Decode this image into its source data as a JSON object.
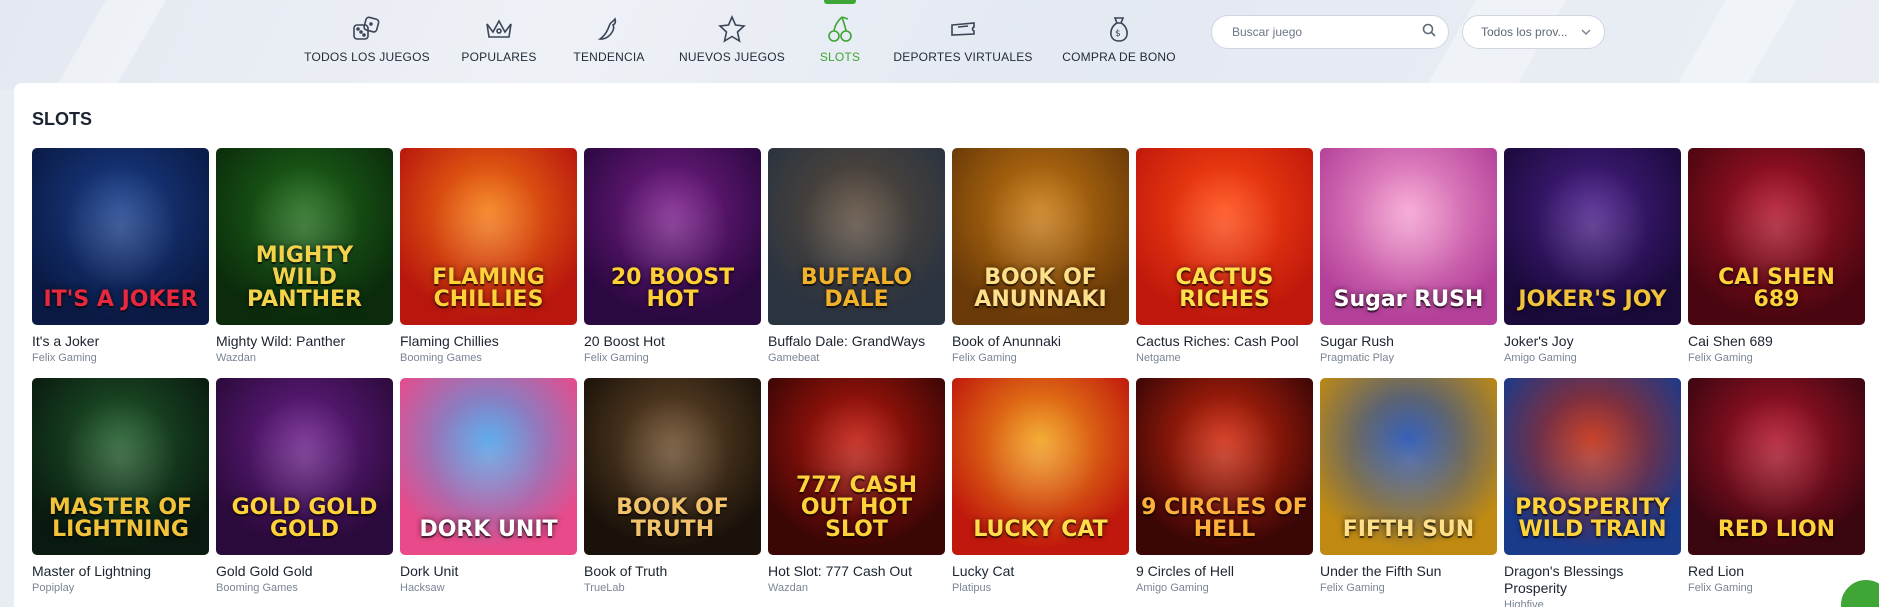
{
  "nav": {
    "items": [
      {
        "label": "TODOS LOS JUEGOS",
        "icon": "dice-icon"
      },
      {
        "label": "POPULARES",
        "icon": "crown-icon"
      },
      {
        "label": "TENDENCIA",
        "icon": "chili-icon"
      },
      {
        "label": "NUEVOS JUEGOS",
        "icon": "star-icon"
      },
      {
        "label": "SLOTS",
        "icon": "cherries-icon",
        "active": true
      },
      {
        "label": "DEPORTES VIRTUALES",
        "icon": "ticket-icon"
      },
      {
        "label": "COMPRA DE BONO",
        "icon": "money-bag-icon"
      }
    ],
    "active_color": "#3fa535"
  },
  "search": {
    "placeholder": "Buscar juego"
  },
  "provider_select": {
    "value": "Todos los prov..."
  },
  "section": {
    "title": "SLOTS"
  },
  "games": [
    {
      "name": "It's a Joker",
      "provider": "Felix Gaming",
      "logo": "IT'S A JOKER"
    },
    {
      "name": "Mighty Wild: Panther",
      "provider": "Wazdan",
      "logo": "MIGHTY WILD PANTHER"
    },
    {
      "name": "Flaming Chillies",
      "provider": "Booming Games",
      "logo": "FLAMING CHILLIES"
    },
    {
      "name": "20 Boost Hot",
      "provider": "Felix Gaming",
      "logo": "20 BOOST HOT"
    },
    {
      "name": "Buffalo Dale: GrandWays",
      "provider": "Gamebeat",
      "logo": "BUFFALO DALE"
    },
    {
      "name": "Book of Anunnaki",
      "provider": "Felix Gaming",
      "logo": "BOOK OF ANUNNAKI"
    },
    {
      "name": "Cactus Riches: Cash Pool",
      "provider": "Netgame",
      "logo": "CACTUS RICHES"
    },
    {
      "name": "Sugar Rush",
      "provider": "Pragmatic Play",
      "logo": "Sugar RUSH"
    },
    {
      "name": "Joker's Joy",
      "provider": "Amigo Gaming",
      "logo": "JOKER'S JOY"
    },
    {
      "name": "Cai Shen 689",
      "provider": "Felix Gaming",
      "logo": "CAI SHEN 689"
    },
    {
      "name": "Master of Lightning",
      "provider": "Popiplay",
      "logo": "MASTER OF LIGHTNING"
    },
    {
      "name": "Gold Gold Gold",
      "provider": "Booming Games",
      "logo": "GOLD GOLD GOLD"
    },
    {
      "name": "Dork Unit",
      "provider": "Hacksaw",
      "logo": "DORK UNIT"
    },
    {
      "name": "Book of Truth",
      "provider": "TrueLab",
      "logo": "BOOK OF TRUTH"
    },
    {
      "name": "Hot Slot: 777 Cash Out",
      "provider": "Wazdan",
      "logo": "777 CASH OUT HOT SLOT"
    },
    {
      "name": "Lucky Cat",
      "provider": "Platipus",
      "logo": "LUCKY CAT"
    },
    {
      "name": "9 Circles of Hell",
      "provider": "Amigo Gaming",
      "logo": "9 CIRCLES OF HELL"
    },
    {
      "name": "Under the Fifth Sun",
      "provider": "Felix Gaming",
      "logo": "FIFTH SUN"
    },
    {
      "name": "Dragon's Blessings Prosperity",
      "provider": "Highfive",
      "logo": "PROSPERITY WILD TRAIN"
    },
    {
      "name": "Red Lion",
      "provider": "Felix Gaming",
      "logo": "RED LION"
    }
  ],
  "colors": {
    "accent": "#3fa535",
    "tiles": [
      [
        "#1a3f8c",
        "#0a1a44",
        "#e8283c"
      ],
      [
        "#1f6b1a",
        "#0b2b0c",
        "#f2d34a"
      ],
      [
        "#f47a12",
        "#b8160e",
        "#ffd23a"
      ],
      [
        "#7a1f8a",
        "#2a0840",
        "#ffcf33"
      ],
      [
        "#5a4a3a",
        "#2a3340",
        "#f2b12a"
      ],
      [
        "#c97a12",
        "#6a3a08",
        "#ffe08a"
      ],
      [
        "#ff4a12",
        "#c0180c",
        "#ffe04a"
      ],
      [
        "#f5a0d0",
        "#b4409a",
        "#ffffff"
      ],
      [
        "#4a1f8a",
        "#1a0a3a",
        "#f2c23a"
      ],
      [
        "#b0142a",
        "#4a0610",
        "#ffd23a"
      ],
      [
        "#1f5a2a",
        "#0a1a10",
        "#f2c23a"
      ],
      [
        "#6a1f8a",
        "#2a0a3a",
        "#ffd23a"
      ],
      [
        "#4aa0e8",
        "#e84a8a",
        "#ffffff"
      ],
      [
        "#6a4a2a",
        "#1a120a",
        "#f2c26a"
      ],
      [
        "#c0180c",
        "#3a0606",
        "#ffd23a"
      ],
      [
        "#f2a01a",
        "#c0180c",
        "#ffe04a"
      ],
      [
        "#d0280c",
        "#3a0606",
        "#ffb03a"
      ],
      [
        "#1a4ab0",
        "#c08a12",
        "#ffe08a"
      ],
      [
        "#c0280c",
        "#1a3a8a",
        "#ffd23a"
      ],
      [
        "#b0142a",
        "#3a0610",
        "#ffd23a"
      ]
    ]
  }
}
